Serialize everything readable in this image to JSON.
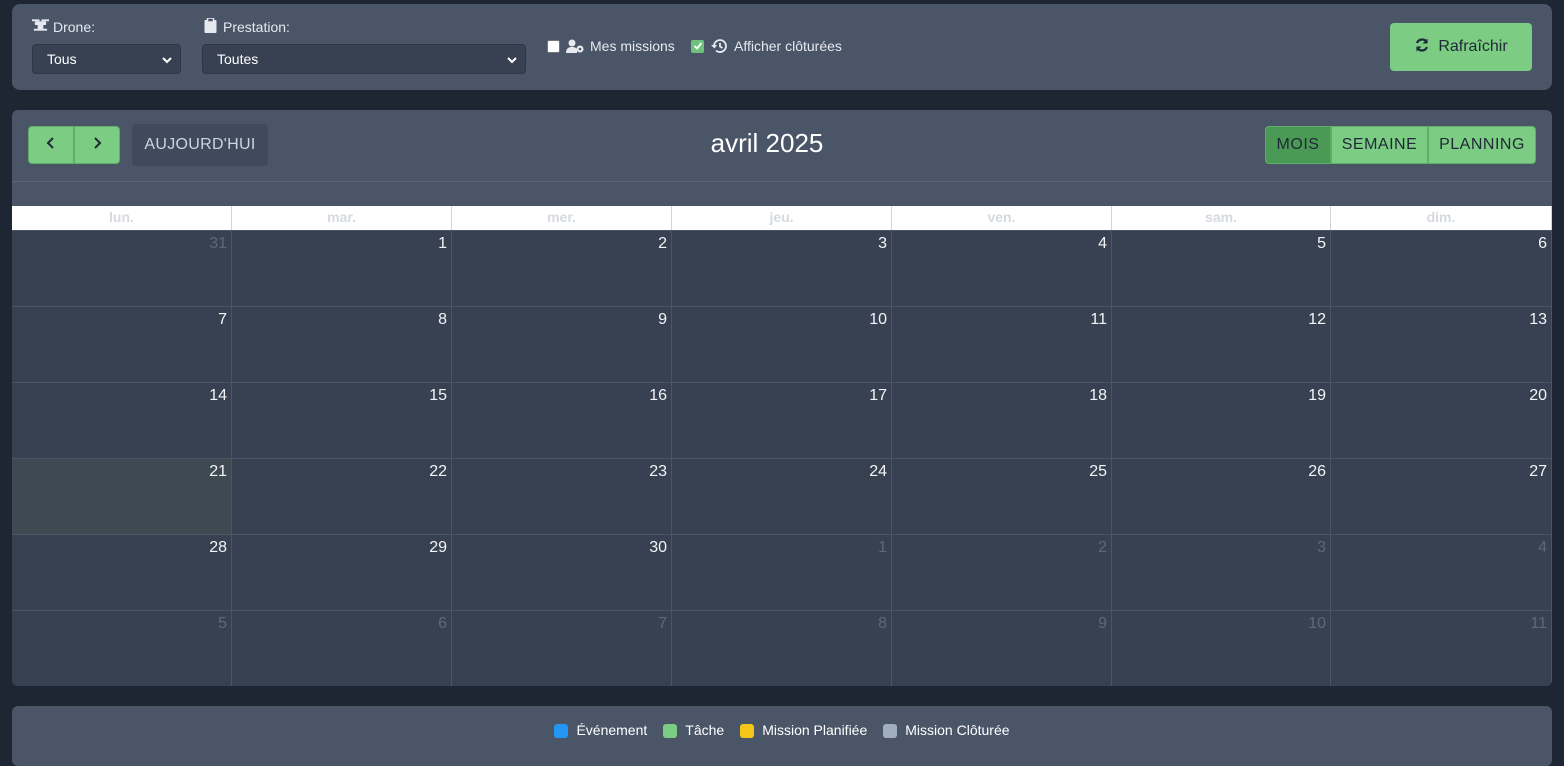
{
  "filters": {
    "drone_label": "Drone:",
    "drone_value": "Tous",
    "prestation_label": "Prestation:",
    "prestation_value": "Toutes",
    "my_missions_label": "Mes missions",
    "my_missions_checked": false,
    "show_closed_label": "Afficher clôturées",
    "show_closed_checked": true,
    "refresh_label": "Rafraîchir"
  },
  "calendar": {
    "today_label": "AUJOURD'HUI",
    "title": "avril 2025",
    "views": [
      "MOIS",
      "SEMAINE",
      "PLANNING"
    ],
    "active_view": "MOIS",
    "weekdays": [
      "lun.",
      "mar.",
      "mer.",
      "jeu.",
      "ven.",
      "sam.",
      "dim."
    ],
    "today_date": "21",
    "weeks": [
      [
        {
          "d": "31",
          "o": true
        },
        {
          "d": "1"
        },
        {
          "d": "2"
        },
        {
          "d": "3"
        },
        {
          "d": "4"
        },
        {
          "d": "5"
        },
        {
          "d": "6"
        }
      ],
      [
        {
          "d": "7"
        },
        {
          "d": "8"
        },
        {
          "d": "9"
        },
        {
          "d": "10"
        },
        {
          "d": "11"
        },
        {
          "d": "12"
        },
        {
          "d": "13"
        }
      ],
      [
        {
          "d": "14"
        },
        {
          "d": "15"
        },
        {
          "d": "16"
        },
        {
          "d": "17"
        },
        {
          "d": "18"
        },
        {
          "d": "19"
        },
        {
          "d": "20"
        }
      ],
      [
        {
          "d": "21",
          "t": true
        },
        {
          "d": "22"
        },
        {
          "d": "23"
        },
        {
          "d": "24"
        },
        {
          "d": "25"
        },
        {
          "d": "26"
        },
        {
          "d": "27"
        }
      ],
      [
        {
          "d": "28"
        },
        {
          "d": "29"
        },
        {
          "d": "30"
        },
        {
          "d": "1",
          "o": true
        },
        {
          "d": "2",
          "o": true
        },
        {
          "d": "3",
          "o": true
        },
        {
          "d": "4",
          "o": true
        }
      ],
      [
        {
          "d": "5",
          "o": true
        },
        {
          "d": "6",
          "o": true
        },
        {
          "d": "7",
          "o": true
        },
        {
          "d": "8",
          "o": true
        },
        {
          "d": "9",
          "o": true
        },
        {
          "d": "10",
          "o": true
        },
        {
          "d": "11",
          "o": true
        }
      ]
    ]
  },
  "legend": [
    {
      "label": "Événement",
      "color": "#2196f3"
    },
    {
      "label": "Tâche",
      "color": "#7ccc83"
    },
    {
      "label": "Mission Planifiée",
      "color": "#f5c518"
    },
    {
      "label": "Mission Clôturée",
      "color": "#a0aec0"
    }
  ],
  "colors": {
    "accent_green": "#7ccc83",
    "active_green": "#4a9a55",
    "panel": "#4a5568",
    "background": "#1e2533"
  }
}
